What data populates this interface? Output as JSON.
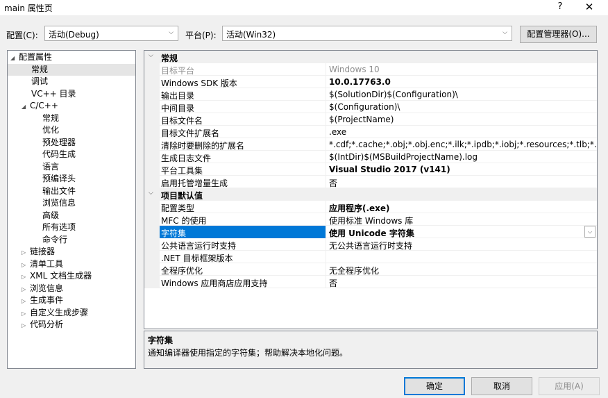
{
  "window": {
    "title": "main 属性页",
    "help": "?",
    "close": "✕"
  },
  "config": {
    "label": "配置(C):",
    "value": "活动(Debug)"
  },
  "platform": {
    "label": "平台(P):",
    "value": "活动(Win32)"
  },
  "config_manager_label": "配置管理器(O)...",
  "tree": [
    {
      "label": "配置属性",
      "expanded": true
    },
    {
      "label": "常规"
    },
    {
      "label": "调试"
    },
    {
      "label": "VC++ 目录"
    },
    {
      "label": "C/C++",
      "expanded": true
    },
    {
      "label": "常规"
    },
    {
      "label": "优化"
    },
    {
      "label": "预处理器"
    },
    {
      "label": "代码生成"
    },
    {
      "label": "语言"
    },
    {
      "label": "预编译头"
    },
    {
      "label": "输出文件"
    },
    {
      "label": "浏览信息"
    },
    {
      "label": "高级"
    },
    {
      "label": "所有选项"
    },
    {
      "label": "命令行"
    },
    {
      "label": "链接器",
      "expanded": false
    },
    {
      "label": "清单工具",
      "expanded": false
    },
    {
      "label": "XML 文档生成器",
      "expanded": false
    },
    {
      "label": "浏览信息",
      "expanded": false
    },
    {
      "label": "生成事件",
      "expanded": false
    },
    {
      "label": "自定义生成步骤",
      "expanded": false
    },
    {
      "label": "代码分析",
      "expanded": false
    }
  ],
  "grid": {
    "categories": [
      {
        "label": "常规"
      },
      {
        "label": "项目默认值"
      }
    ],
    "rows": [
      {
        "name": "目标平台",
        "value": "Windows 10"
      },
      {
        "name": "Windows SDK 版本",
        "value": "10.0.17763.0"
      },
      {
        "name": "输出目录",
        "value": "$(SolutionDir)$(Configuration)\\"
      },
      {
        "name": "中间目录",
        "value": "$(Configuration)\\"
      },
      {
        "name": "目标文件名",
        "value": "$(ProjectName)"
      },
      {
        "name": "目标文件扩展名",
        "value": ".exe"
      },
      {
        "name": "清除时要删除的扩展名",
        "value": "*.cdf;*.cache;*.obj;*.obj.enc;*.ilk;*.ipdb;*.iobj;*.resources;*.tlb;*.tli;*"
      },
      {
        "name": "生成日志文件",
        "value": "$(IntDir)$(MSBuildProjectName).log"
      },
      {
        "name": "平台工具集",
        "value": "Visual Studio 2017 (v141)"
      },
      {
        "name": "启用托管增量生成",
        "value": "否"
      },
      {
        "name": "配置类型",
        "value": "应用程序(.exe)"
      },
      {
        "name": "MFC 的使用",
        "value": "使用标准 Windows 库"
      },
      {
        "name": "字符集",
        "value": "使用 Unicode 字符集"
      },
      {
        "name": "公共语言运行时支持",
        "value": "无公共语言运行时支持"
      },
      {
        "name": ".NET 目标框架版本",
        "value": ""
      },
      {
        "name": "全程序优化",
        "value": "无全程序优化"
      },
      {
        "name": "Windows 应用商店应用支持",
        "value": "否"
      }
    ]
  },
  "description": {
    "title": "字符集",
    "text": "通知编译器使用指定的字符集；帮助解决本地化问题。"
  },
  "buttons": {
    "ok": "确定",
    "cancel": "取消",
    "apply": "应用(A)"
  }
}
